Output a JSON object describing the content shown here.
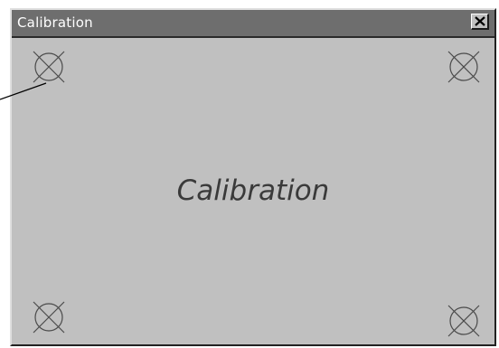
{
  "window": {
    "title": "Calibration",
    "close_label": "×"
  },
  "main": {
    "center_text": "Calibration"
  },
  "targets": [
    {
      "name": "top-left",
      "icon": "crosshair-target-icon"
    },
    {
      "name": "top-right",
      "icon": "crosshair-target-icon"
    },
    {
      "name": "bottom-left",
      "icon": "crosshair-target-icon"
    },
    {
      "name": "bottom-right",
      "icon": "crosshair-target-icon"
    }
  ],
  "colors": {
    "titlebar": "#6e6e6e",
    "client": "#c0c0c0",
    "target_stroke": "#4a4a4a",
    "center_text": "#3a3a3a"
  }
}
